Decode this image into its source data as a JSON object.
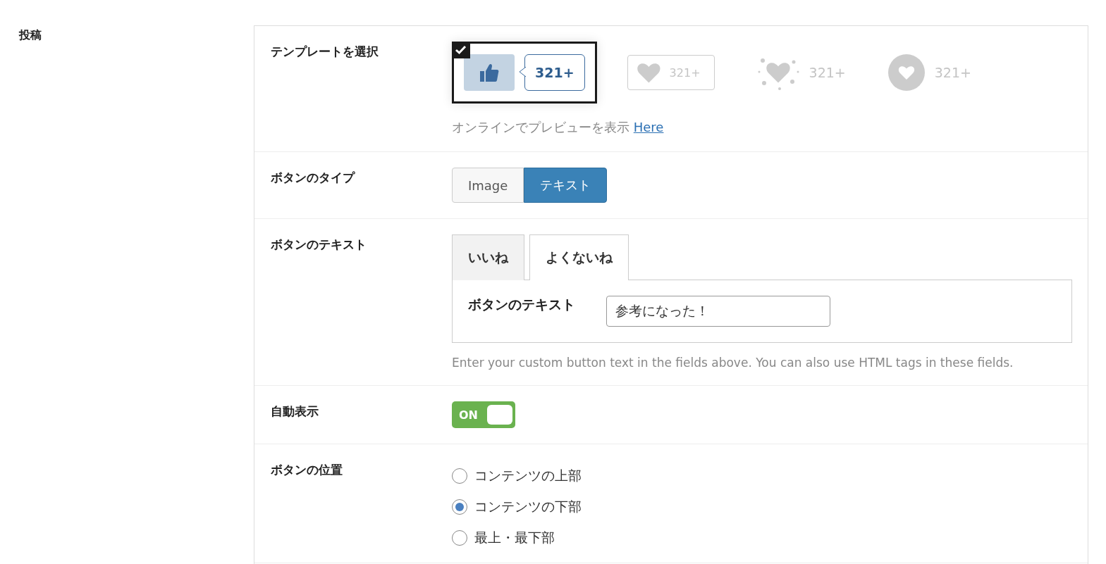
{
  "section_title": "投稿",
  "rows": [
    {
      "kind": "templates",
      "label": "テンプレートを選択",
      "templates": [
        {
          "kind": "thumb-bubble",
          "count": "321+",
          "selected": true
        },
        {
          "kind": "heart-box",
          "count": "321+",
          "selected": false
        },
        {
          "kind": "heart-sparkle",
          "count": "321+",
          "selected": false
        },
        {
          "kind": "heart-circle",
          "count": "321+",
          "selected": false
        }
      ],
      "preview_text": "オンラインでプレビューを表示",
      "preview_link": "Here"
    },
    {
      "kind": "segmented",
      "label": "ボタンのタイプ",
      "options": [
        {
          "label": "Image",
          "selected": false
        },
        {
          "label": "テキスト",
          "selected": true
        }
      ]
    },
    {
      "kind": "tabs",
      "label": "ボタンのテキスト",
      "tabs": [
        {
          "label": "いいね",
          "selected": false
        },
        {
          "label": "よくないね",
          "selected": true
        }
      ],
      "field_label": "ボタンのテキスト",
      "field_value": "参考になった！",
      "help": "Enter your custom button text in the fields above. You can also use HTML tags in these fields."
    },
    {
      "kind": "toggle",
      "label": "自動表示",
      "toggle": {
        "on": true,
        "text": "ON"
      }
    },
    {
      "kind": "radios",
      "label": "ボタンの位置",
      "options": [
        {
          "label": "コンテンツの上部",
          "selected": false
        },
        {
          "label": "コンテンツの下部",
          "selected": true
        },
        {
          "label": "最上・最下部",
          "selected": false
        }
      ]
    }
  ]
}
